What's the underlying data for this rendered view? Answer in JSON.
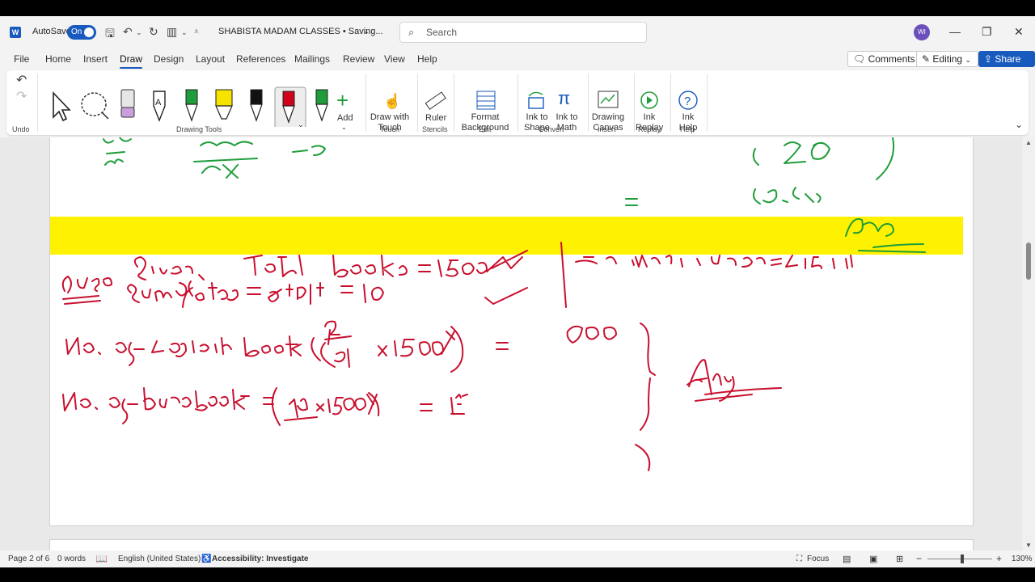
{
  "titlebar": {
    "autosave_label": "AutoSave",
    "autosave_state": "On",
    "doc_title": "SHABISTA MADAM CLASSES • Saving...",
    "search_placeholder": "Search",
    "avatar_initials": "WI"
  },
  "tabs": [
    "File",
    "Home",
    "Insert",
    "Draw",
    "Design",
    "Layout",
    "References",
    "Mailings",
    "Review",
    "View",
    "Help"
  ],
  "active_tab": "Draw",
  "top_buttons": {
    "comments": "Comments",
    "editing": "Editing",
    "share": "Share"
  },
  "ribbon": {
    "undo_group": "Undo",
    "drawing_tools_group": "Drawing Tools",
    "add_label": "Add",
    "draw_with_touch": [
      "Draw with",
      "Touch"
    ],
    "touch_group": "Touch",
    "ruler": "Ruler",
    "stencils_group": "Stencils",
    "format_background": [
      "Format",
      "Background"
    ],
    "edit_group": "Edit",
    "ink_to_shape": [
      "Ink to",
      "Shape"
    ],
    "ink_to_math": [
      "Ink to",
      "Math"
    ],
    "convert_group": "Convert",
    "drawing_canvas": [
      "Drawing",
      "Canvas"
    ],
    "insert_group": "Insert",
    "ink_replay": [
      "Ink",
      "Replay"
    ],
    "replay_group": "Replay",
    "ink_help": [
      "Ink",
      "Help"
    ],
    "help_group": "Help",
    "pen_colors": [
      "#9b59b6",
      "#333333",
      "#1f9d3a",
      "#f7e300",
      "#111111",
      "#d0021b",
      "#1f9d3a"
    ]
  },
  "status": {
    "page": "Page 2 of 6",
    "words": "0 words",
    "language": "English (United States)",
    "accessibility": "Accessibility: Investigate",
    "focus": "Focus",
    "zoom": "130%"
  },
  "ink_color": "#c8102e",
  "ink_green": "#1f9d3a"
}
